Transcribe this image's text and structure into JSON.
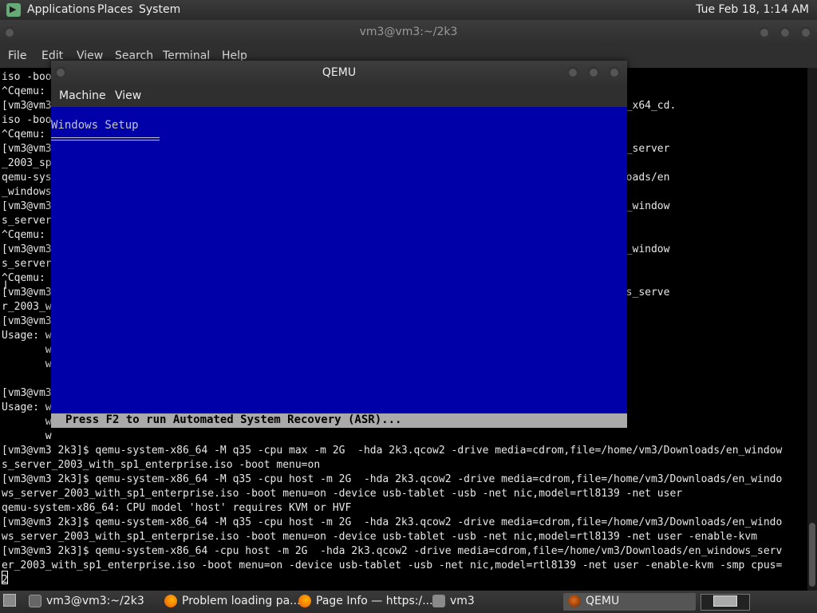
{
  "top_panel": {
    "menus": [
      "Applications",
      "Places",
      "System"
    ],
    "clock": "Tue Feb 18, 1:14 AM"
  },
  "terminal": {
    "title": "vm3@vm3:~/2k3",
    "menu": [
      "File",
      "Edit",
      "View",
      "Search",
      "Terminal",
      "Help"
    ],
    "lines": [
      "iso -boo",
      "^Cqemu:",
      "[vm3@vm3                                                                         ows_server_2003_sp2_x64_cd.",
      "iso -boo",
      "^Cqemu:",
      "[vm3@vm3                                                                        Downloads/en_windows_server",
      "_2003_sp",
      "qemu-sys                                                                        ld not open '~/Downloads/en",
      "_windows",
      "[vm3@vm3                                                                        ome/vm3/Downloads/en_window",
      "s_server",
      "^Cqemu:",
      "[vm3@vm3                                                                        ome/vm3/Downloads/en_window",
      "s_server",
      "^Cqemu:",
      "[vm3@vm3                                                                        /Downloads/en_windows_serve",
      "r_2003_w",
      "[vm3@vm3",
      "Usage: w",
      "       w",
      "       w",
      "",
      "[vm3@vm3",
      "Usage: w",
      "       w",
      "       w",
      "[vm3@vm3 2k3]$ qemu-system-x86_64 -M q35 -cpu max -m 2G  -hda 2k3.qcow2 -drive media=cdrom,file=/home/vm3/Downloads/en_window",
      "s_server_2003_with_sp1_enterprise.iso -boot menu=on",
      "[vm3@vm3 2k3]$ qemu-system-x86_64 -M q35 -cpu host -m 2G  -hda 2k3.qcow2 -drive media=cdrom,file=/home/vm3/Downloads/en_windo",
      "ws_server_2003_with_sp1_enterprise.iso -boot menu=on -device usb-tablet -usb -net nic,model=rtl8139 -net user",
      "qemu-system-x86_64: CPU model 'host' requires KVM or HVF",
      "[vm3@vm3 2k3]$ qemu-system-x86_64 -M q35 -cpu host -m 2G  -hda 2k3.qcow2 -drive media=cdrom,file=/home/vm3/Downloads/en_windo",
      "ws_server_2003_with_sp1_enterprise.iso -boot menu=on -device usb-tablet -usb -net nic,model=rtl8139 -net user -enable-kvm",
      "[vm3@vm3 2k3]$ qemu-system-x86_64 -cpu host -m 2G  -hda 2k3.qcow2 -drive media=cdrom,file=/home/vm3/Downloads/en_windows_serv",
      "er_2003_with_sp1_enterprise.iso -boot menu=on -device usb-tablet -usb -net nic,model=rtl8139 -net user -enable-kvm -smp cpus=",
      "2"
    ]
  },
  "qemu": {
    "title": "QEMU",
    "menu": [
      "Machine",
      "View"
    ],
    "setup_title": "Windows Setup",
    "asr_prompt": "Press F2 to run Automated System Recovery (ASR)..."
  },
  "taskbar": {
    "tasks": [
      {
        "label": "vm3@vm3:~/2k3",
        "icon": "terminal-icon"
      },
      {
        "label": "Problem loading pa...",
        "icon": "firefox-icon"
      },
      {
        "label": "Page Info — https:/...",
        "icon": "firefox-icon"
      },
      {
        "label": "vm3",
        "icon": "folder-icon"
      },
      {
        "label": "QEMU",
        "icon": "qemu-icon"
      }
    ]
  },
  "colors": {
    "setup_blue": "#0000a8",
    "status_bar_gray": "#aaaaaa",
    "terminal_bg": "#000000"
  }
}
